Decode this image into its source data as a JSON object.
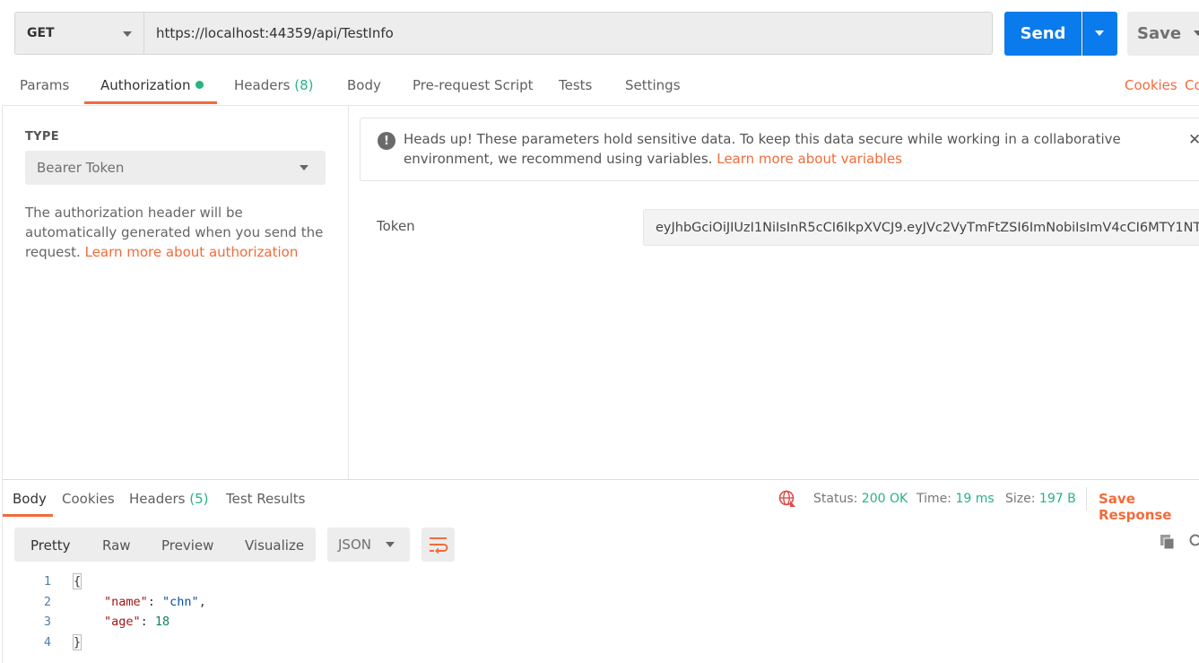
{
  "request": {
    "method": "GET",
    "url": "https://localhost:44359/api/TestInfo",
    "send_label": "Send",
    "save_label": "Save"
  },
  "tabs": {
    "params": "Params",
    "authorization": "Authorization",
    "headers": "Headers",
    "headers_count": "(8)",
    "body": "Body",
    "prerequest": "Pre-request Script",
    "tests": "Tests",
    "settings": "Settings",
    "cookies": "Cookies",
    "code": "Co"
  },
  "auth": {
    "type_label": "TYPE",
    "type_value": "Bearer Token",
    "description": "The authorization header will be automatically generated when you send the request.",
    "learn_more": "Learn more about authorization",
    "notice": "Heads up! These parameters hold sensitive data. To keep this data secure while working in a collaborative environment, we recommend using variables.",
    "notice_link": "Learn more about variables",
    "token_label": "Token",
    "token_value": "eyJhbGciOiJIUzI1NiIsInR5cCI6IkpXVCJ9.eyJVc2VyTmFtZSI6ImNobiIsImV4cCI6MTY1NT..."
  },
  "response": {
    "tabs": {
      "body": "Body",
      "cookies": "Cookies",
      "headers": "Headers",
      "headers_count": "(5)",
      "test_results": "Test Results"
    },
    "status_label": "Status:",
    "status_value": "200 OK",
    "time_label": "Time:",
    "time_value": "19 ms",
    "size_label": "Size:",
    "size_value": "197 B",
    "save_response": "Save Response",
    "formats": {
      "pretty": "Pretty",
      "raw": "Raw",
      "preview": "Preview",
      "visualize": "Visualize"
    },
    "language": "JSON",
    "lines": [
      {
        "n": "1",
        "open": "{"
      },
      {
        "n": "2",
        "key": "\"name\"",
        "sep": ": ",
        "val": "\"chn\"",
        "tail": ","
      },
      {
        "n": "3",
        "key": "\"age\"",
        "sep": ": ",
        "val": "18",
        "tail": ""
      },
      {
        "n": "4",
        "close": "}"
      }
    ]
  },
  "colors": {
    "accent": "#f26b3a",
    "send_blue": "#097bed",
    "success": "#26b47f"
  }
}
